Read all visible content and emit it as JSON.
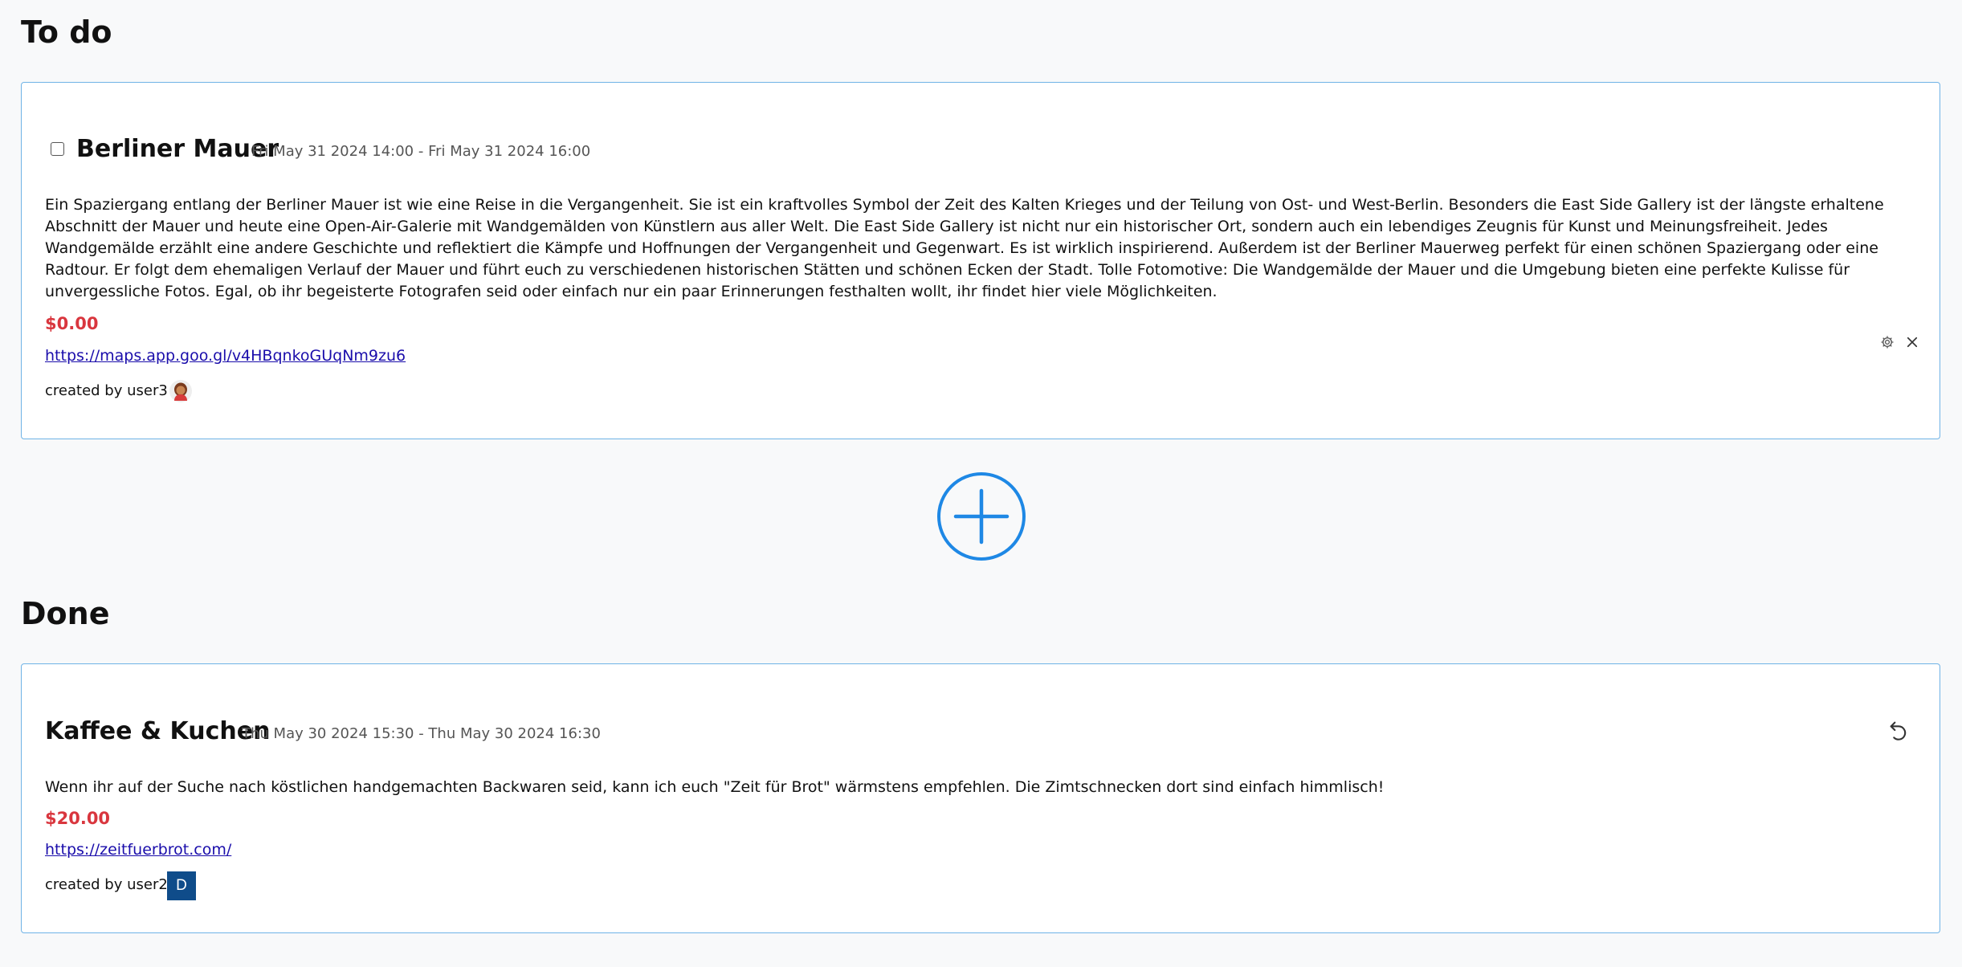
{
  "sections": {
    "todo_title": "To do",
    "done_title": "Done"
  },
  "todo_card": {
    "title": "Berliner Mauer",
    "dates": "Fri May 31 2024 14:00 - Fri May 31 2024 16:00",
    "description": "Ein Spaziergang entlang der Berliner Mauer ist wie eine Reise in die Vergangenheit. Sie ist ein kraftvolles Symbol der Zeit des Kalten Krieges und der Teilung von Ost- und West-Berlin. Besonders die East Side Gallery ist der längste erhaltene Abschnitt der Mauer und heute eine Open-Air-Galerie mit Wandgemälden von Künstlern aus aller Welt. Die East Side Gallery ist nicht nur ein historischer Ort, sondern auch ein lebendiges Zeugnis für Kunst und Meinungsfreiheit. Jedes Wandgemälde erzählt eine andere Geschichte und reflektiert die Kämpfe und Hoffnungen der Vergangenheit und Gegenwart. Es ist wirklich inspirierend. Außerdem ist der Berliner Mauerweg perfekt für einen schönen Spaziergang oder eine Radtour. Er folgt dem ehemaligen Verlauf der Mauer und führt euch zu verschiedenen historischen Stätten und schönen Ecken der Stadt. Tolle Fotomotive: Die Wandgemälde der Mauer und die Umgebung bieten eine perfekte Kulisse für unvergessliche Fotos. Egal, ob ihr begeisterte Fotografen seid oder einfach nur ein paar Erinnerungen festhalten wollt, ihr findet hier viele Möglichkeiten.",
    "price": "$0.00",
    "link": "https://maps.app.goo.gl/v4HBqnkoGUqNm9zu6",
    "created_by": "created by user3",
    "checked": false,
    "avatar_icon": "person-avatar-icon"
  },
  "done_card": {
    "title": "Kaffee & Kuchen",
    "dates": "Thu May 30 2024 15:30 - Thu May 30 2024 16:30",
    "description": "Wenn ihr auf der Suche nach köstlichen handgemachten Backwaren seid, kann ich euch \"Zeit für Brot\" wärmstens empfehlen. Die Zimtschnecken dort sind einfach himmlisch!",
    "price": "$20.00",
    "link": "https://zeitfuerbrot.com/",
    "created_by": "created by user2",
    "avatar_letter": "D"
  },
  "colors": {
    "accent": "#1e88e5",
    "price": "#d9363e",
    "card_border": "#6fb3e6",
    "avatar_bg": "#0f4c8a",
    "link": "#1a0dab"
  },
  "icons": {
    "settings": "gear-icon",
    "close": "close-icon",
    "undo": "undo-icon",
    "add": "plus-circle-icon"
  }
}
